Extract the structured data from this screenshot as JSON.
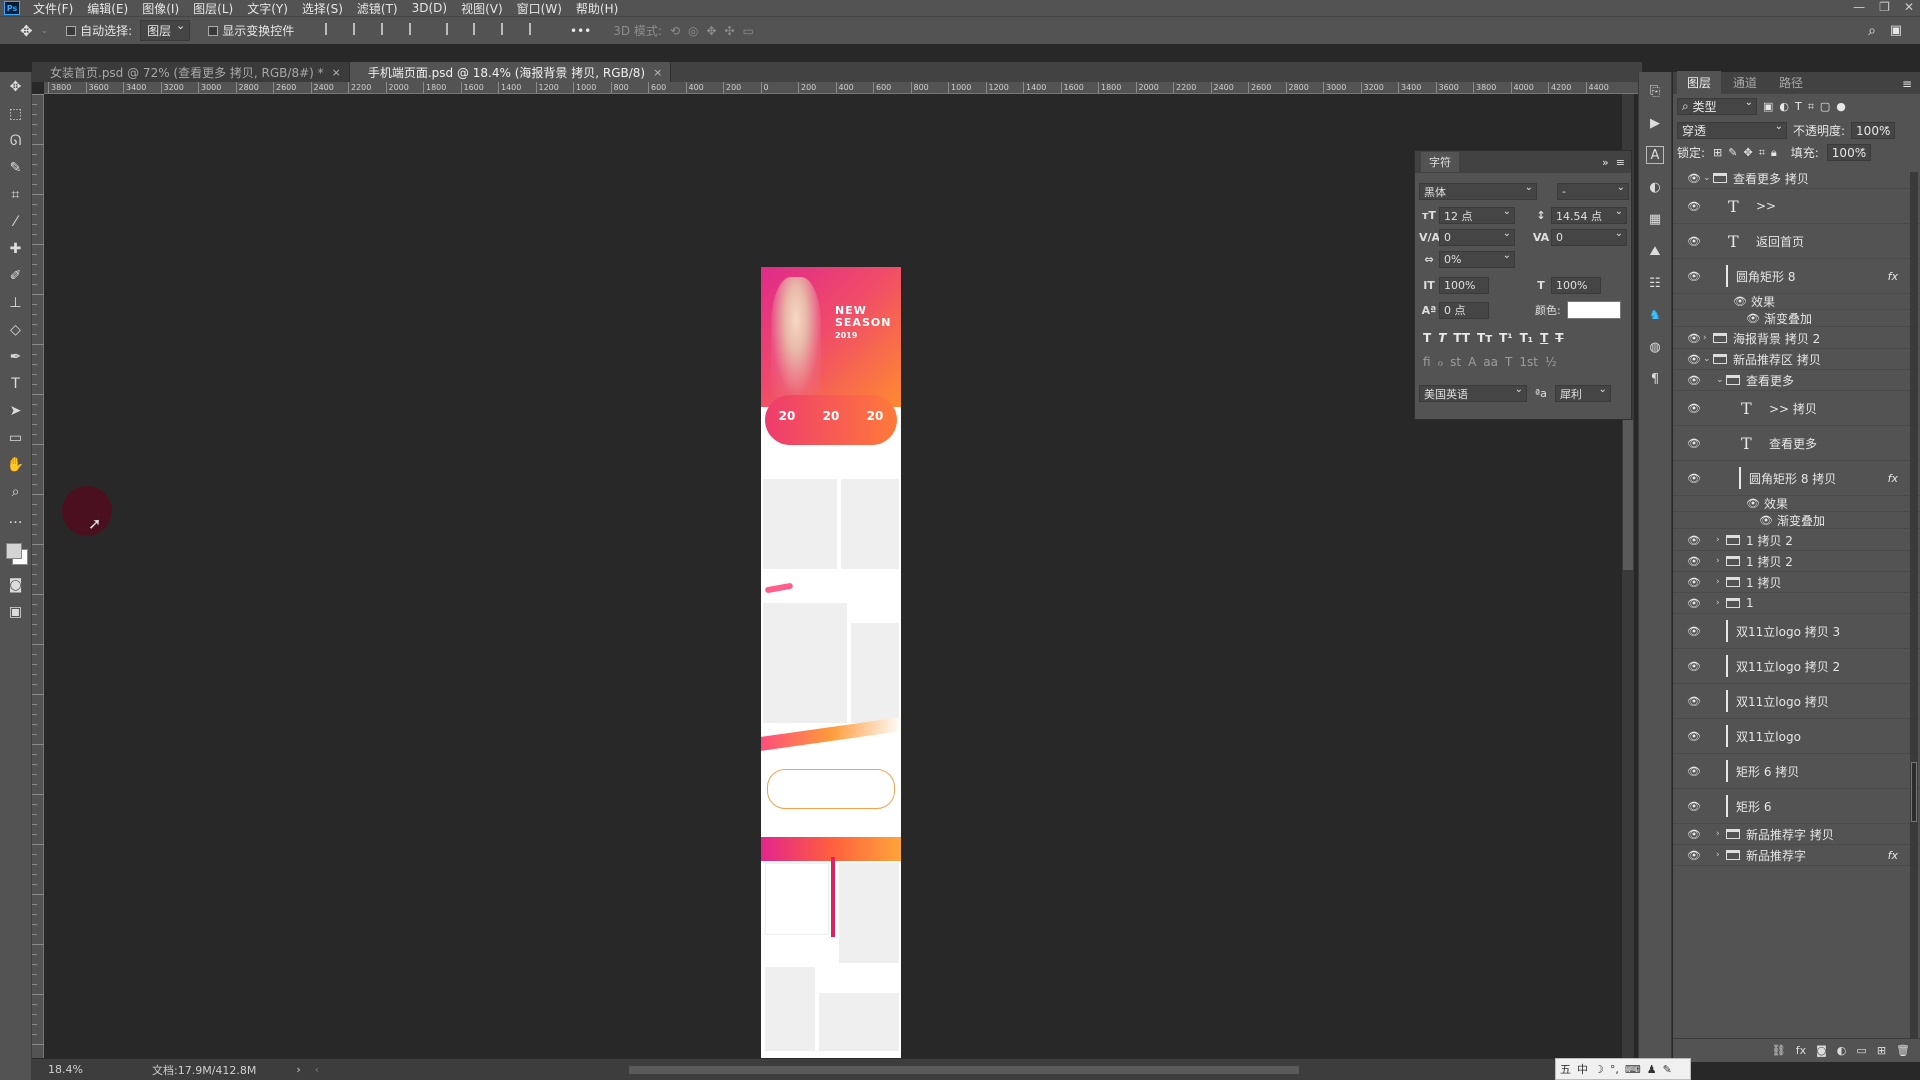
{
  "app": {
    "logo": "Ps"
  },
  "menu": [
    "文件(F)",
    "编辑(E)",
    "图像(I)",
    "图层(L)",
    "文字(Y)",
    "选择(S)",
    "滤镜(T)",
    "3D(D)",
    "视图(V)",
    "窗口(W)",
    "帮助(H)"
  ],
  "window_controls": {
    "minimize": "—",
    "restore": "❐",
    "close": "✕"
  },
  "options": {
    "auto_select_label": "自动选择:",
    "auto_select_value": "图层",
    "show_transform_label": "显示变换控件",
    "more": "•••",
    "mode_3d": "3D 模式:"
  },
  "tabs": [
    {
      "label": "女装首页.psd @ 72% (查看更多 拷贝, RGB/8#) *",
      "close": "×"
    },
    {
      "label": "手机端页面.psd @ 18.4% (海报背景 拷贝, RGB/8)",
      "close": "×"
    }
  ],
  "ruler": {
    "h_ticks": [
      "3800",
      "3600",
      "3400",
      "3200",
      "3000",
      "2800",
      "2600",
      "2400",
      "2200",
      "2000",
      "1800",
      "1600",
      "1400",
      "1200",
      "1000",
      "800",
      "600",
      "400",
      "200",
      "0",
      "200",
      "400",
      "600",
      "800",
      "1000",
      "1200",
      "1400",
      "1600",
      "1800",
      "2000",
      "2200",
      "2400",
      "2600",
      "2800",
      "3000",
      "3200",
      "3400",
      "3600",
      "3800",
      "4000",
      "4200",
      "4400"
    ]
  },
  "document": {
    "hero_title": "NEW\nSEASON",
    "hero_year": "2019",
    "coupons": [
      "20",
      "20",
      "20"
    ]
  },
  "status": {
    "zoom": "18.4%",
    "doc_size": "文档:17.9M/412.8M"
  },
  "character_panel": {
    "title": "字符",
    "font_family": "黑体",
    "font_style": "-",
    "font_size": "12 点",
    "leading": "14.54 点",
    "kerning": "0",
    "tracking": "0",
    "scale_pct": "0%",
    "vertical_scale": "100%",
    "horizontal_scale": "100%",
    "baseline": "0 点",
    "color_label": "颜色:",
    "color_value": "#ffffff",
    "language": "美国英语",
    "aa_icon": "ªa",
    "antialias": "犀利",
    "style_buttons": [
      "T",
      "T",
      "TT",
      "Tт",
      "T¹",
      "T₁",
      "T",
      "T"
    ],
    "opentype_buttons": [
      "fi",
      "ℴ",
      "st",
      "A",
      "aa",
      "T",
      "1st",
      "½"
    ]
  },
  "layers_panel": {
    "tabs": [
      "图层",
      "通道",
      "路径"
    ],
    "filter_label": "类型",
    "blend_mode": "穿透",
    "opacity_label": "不透明度:",
    "opacity": "100%",
    "lock_label": "锁定:",
    "fill_label": "填充:",
    "fill": "100%",
    "layers": [
      {
        "name": "查看更多 拷贝",
        "kind": "group-open",
        "indent": 0
      },
      {
        "name": ">>",
        "kind": "text",
        "indent": 1
      },
      {
        "name": "返回首页",
        "kind": "text",
        "indent": 1
      },
      {
        "name": "圆角矩形 8",
        "kind": "shape",
        "indent": 1,
        "fx": "fx"
      },
      {
        "name": "效果",
        "kind": "effect",
        "indent": 2
      },
      {
        "name": "渐变叠加",
        "kind": "effect",
        "indent": 3
      },
      {
        "name": "海报背景 拷贝 2",
        "kind": "group",
        "indent": 0
      },
      {
        "name": "新品推荐区 拷贝",
        "kind": "group-open",
        "indent": 0
      },
      {
        "name": "查看更多",
        "kind": "group-open",
        "indent": 1
      },
      {
        "name": ">> 拷贝",
        "kind": "text",
        "indent": 2
      },
      {
        "name": "查看更多",
        "kind": "text",
        "indent": 2
      },
      {
        "name": "圆角矩形 8 拷贝",
        "kind": "shape",
        "indent": 2,
        "fx": "fx"
      },
      {
        "name": "效果",
        "kind": "effect",
        "indent": 3
      },
      {
        "name": "渐变叠加",
        "kind": "effect",
        "indent": 4
      },
      {
        "name": "1 拷贝 2",
        "kind": "group",
        "indent": 1
      },
      {
        "name": "1 拷贝 2",
        "kind": "group",
        "indent": 1
      },
      {
        "name": "1 拷贝",
        "kind": "group",
        "indent": 1
      },
      {
        "name": "1",
        "kind": "group",
        "indent": 1
      },
      {
        "name": "双11立logo 拷贝 3",
        "kind": "shape",
        "indent": 1
      },
      {
        "name": "双11立logo 拷贝 2",
        "kind": "shape",
        "indent": 1
      },
      {
        "name": "双11立logo 拷贝",
        "kind": "shape",
        "indent": 1
      },
      {
        "name": "双11立logo",
        "kind": "shape",
        "indent": 1
      },
      {
        "name": "矩形 6 拷贝",
        "kind": "shape",
        "indent": 1
      },
      {
        "name": "矩形 6",
        "kind": "shape",
        "indent": 1
      },
      {
        "name": "新品推荐字 拷贝",
        "kind": "group",
        "indent": 1
      },
      {
        "name": "新品推荐字",
        "kind": "group",
        "indent": 1,
        "fx": "fx"
      }
    ]
  },
  "ime": {
    "items": [
      "五",
      "中",
      "☽",
      "°,",
      "⌨",
      "♟",
      "✎"
    ]
  }
}
